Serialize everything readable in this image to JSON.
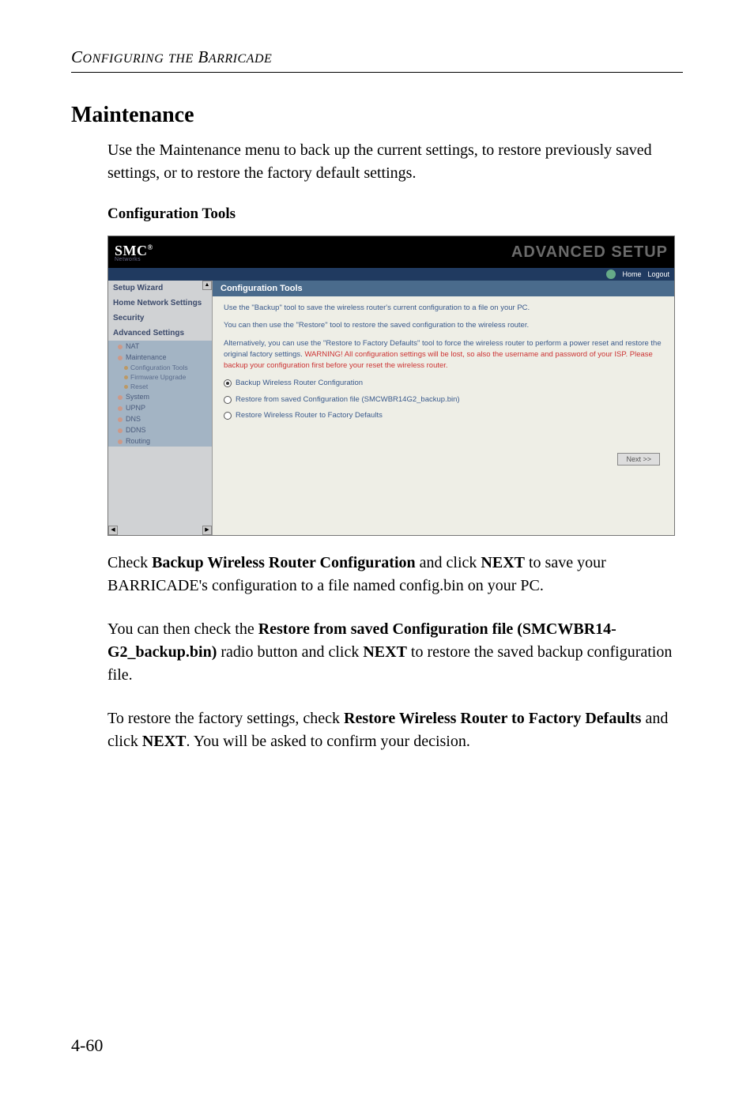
{
  "header": {
    "running": "CONFIGURING THE BARRICADE"
  },
  "section": {
    "title": "Maintenance",
    "intro": "Use the Maintenance menu to back up the current settings, to restore previously saved settings, or to restore the factory default settings."
  },
  "subsection": {
    "title": "Configuration Tools"
  },
  "screenshot": {
    "logo": "SMC",
    "logo_sup": "®",
    "logo_sub": "Networks",
    "top_title": "ADVANCED SETUP",
    "bar_home": "Home",
    "bar_logout": "Logout",
    "sidebar": {
      "setup_wizard": "Setup Wizard",
      "home_network": "Home Network Settings",
      "security": "Security",
      "advanced": "Advanced Settings",
      "nat": "NAT",
      "maintenance": "Maintenance",
      "cfg_tools": "Configuration Tools",
      "fw_upgrade": "Firmware Upgrade",
      "reset": "Reset",
      "system": "System",
      "upnp": "UPNP",
      "dns": "DNS",
      "ddns": "DDNS",
      "routing": "Routing"
    },
    "main": {
      "heading": "Configuration Tools",
      "line1": "Use the \"Backup\" tool to save the wireless router's current configuration to a file on your PC.",
      "line2": "You can then use the \"Restore\" tool to restore the saved configuration to the wireless router.",
      "line3a": "Alternatively, you can use the \"Restore to Factory Defaults\" tool to force the wireless router to perform a power reset and restore the original factory settings. ",
      "line3_warn": "WARNING!",
      "line3b": " All configuration settings will be lost, so also the username and password of your ISP. Please backup your configuration first before your reset the wireless router.",
      "opt_backup": "Backup Wireless Router Configuration",
      "opt_restore": "Restore from saved Configuration file (SMCWBR14G2_backup.bin)",
      "opt_factory": "Restore Wireless Router to Factory Defaults",
      "next": "Next >>"
    }
  },
  "after": {
    "p1a": "Check ",
    "p1b": "Backup Wireless Router Configuration",
    "p1c": " and click ",
    "p1d": "NEXT",
    "p1e": " to save your BARRICADE's configuration to a file named config.bin on your PC.",
    "p2a": "You can then check the ",
    "p2b": "Restore from saved Configuration file (SMCWBR14-G2_backup.bin)",
    "p2c": " radio button and click ",
    "p2d": "NEXT",
    "p2e": " to restore the saved backup configuration file.",
    "p3a": "To restore the factory settings, check ",
    "p3b": "Restore Wireless Router to Factory Defaults",
    "p3c": " and click ",
    "p3d": "NEXT",
    "p3e": ". You will be asked to confirm your decision."
  },
  "page_number": "4-60"
}
